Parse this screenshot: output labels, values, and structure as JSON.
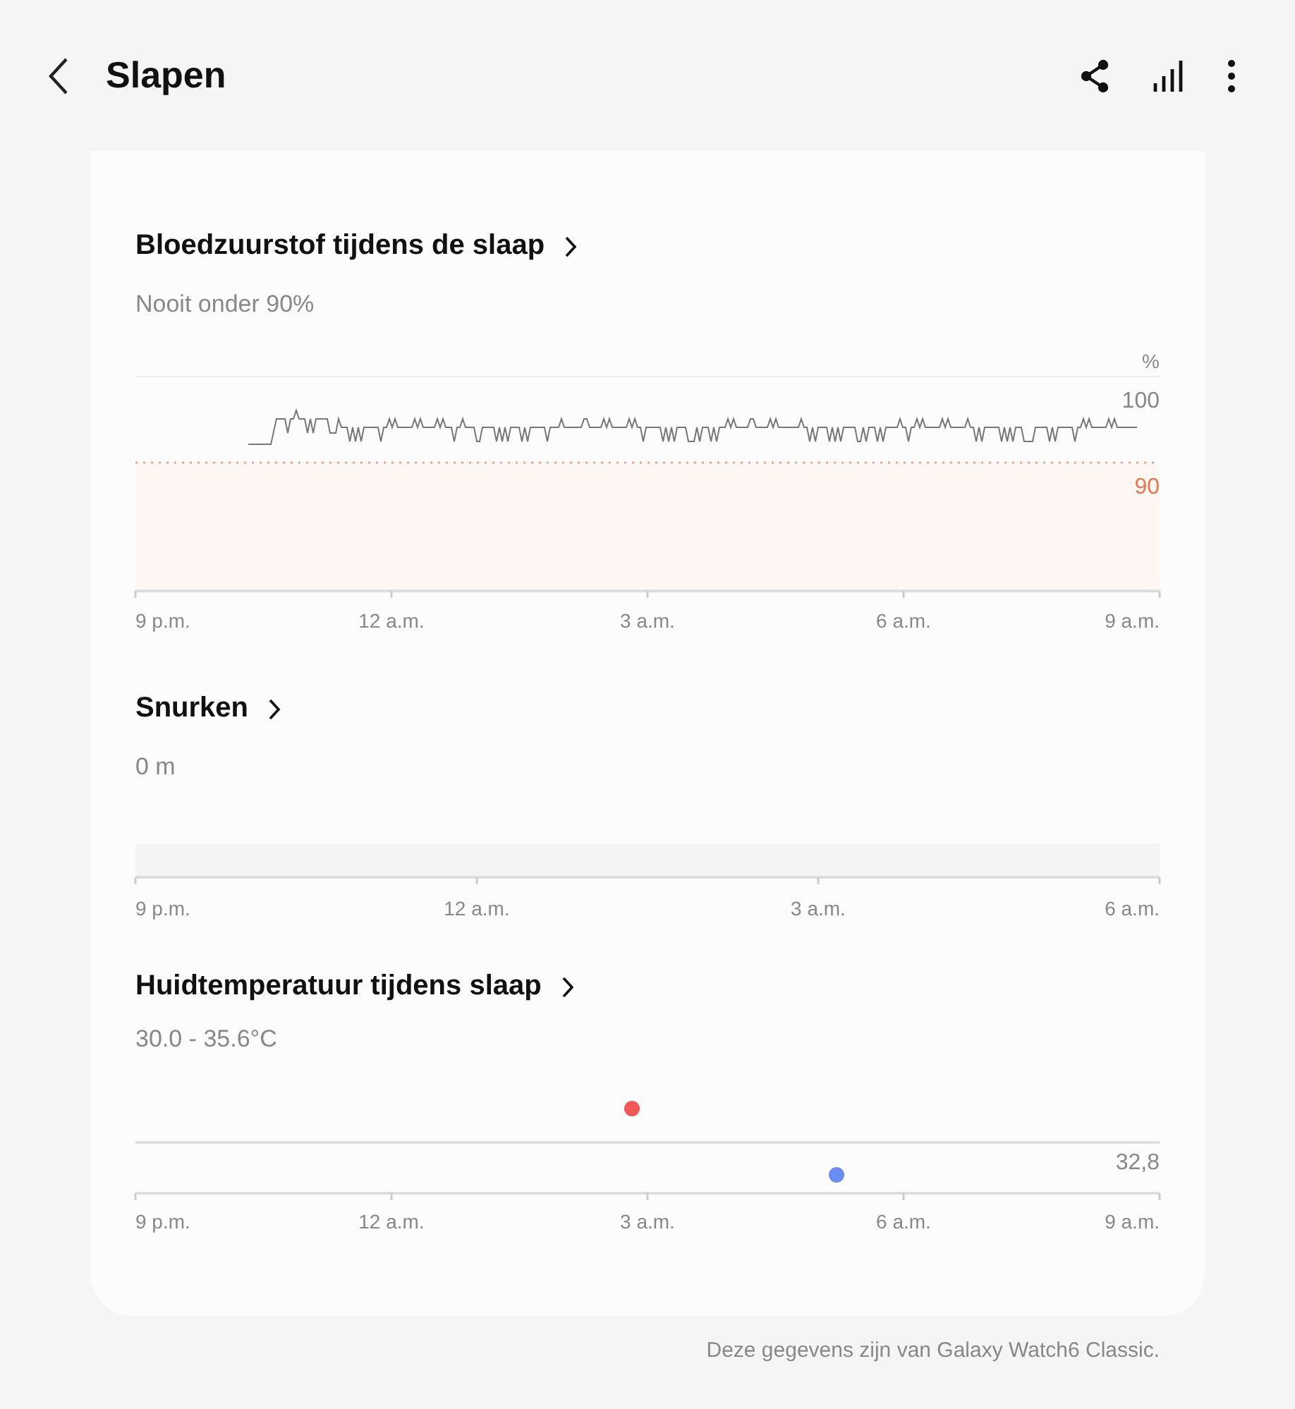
{
  "header": {
    "title": "Slapen"
  },
  "sections": [
    {
      "kind": "spo2",
      "title": "Bloedzuurstof tijdens de slaap",
      "summary": "Nooit onder 90%",
      "unit": "%",
      "top_label": "100",
      "threshold_label": "90",
      "x_labels": [
        "9 p.m.",
        "12 a.m.",
        "3 a.m.",
        "6 a.m.",
        "9 a.m."
      ]
    },
    {
      "kind": "snoring",
      "title": "Snurken",
      "summary": "0 m",
      "x_labels": [
        "9 p.m.",
        "12 a.m.",
        "3 a.m.",
        "6 a.m."
      ]
    },
    {
      "kind": "temperature",
      "title": "Huidtemperatuur tijdens slaap",
      "summary": "30.0 - 35.6°C",
      "reference_label": "32,8",
      "markers": [
        {
          "kind": "high",
          "color": "#f25757"
        },
        {
          "kind": "low",
          "color": "#6b8cf0"
        }
      ],
      "x_labels": [
        "9 p.m.",
        "12 a.m.",
        "3 a.m.",
        "6 a.m.",
        "9 a.m."
      ]
    }
  ],
  "footer": "Deze gegevens zijn van Galaxy Watch6 Classic."
}
